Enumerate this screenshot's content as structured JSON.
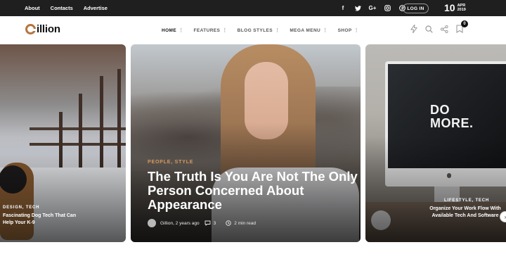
{
  "topbar": {
    "links": [
      "About",
      "Contacts",
      "Advertise"
    ],
    "socials": [
      {
        "icon": "facebook-icon",
        "glyph": "f"
      },
      {
        "icon": "twitter-icon",
        "glyph": "🐦"
      },
      {
        "icon": "google-plus-icon",
        "glyph": "G+"
      },
      {
        "icon": "instagram-icon",
        "glyph": "◎"
      },
      {
        "icon": "pinterest-icon",
        "glyph": "℗"
      }
    ],
    "login_label": "LOG IN",
    "date": {
      "day": "10",
      "month": "APR",
      "year": "2019"
    }
  },
  "header": {
    "logo_text": "illion",
    "nav": [
      {
        "label": "HOME",
        "active": true
      },
      {
        "label": "FEATURES",
        "active": false
      },
      {
        "label": "BLOG STYLES",
        "active": false
      },
      {
        "label": "MEGA MENU",
        "active": false
      },
      {
        "label": "SHOP",
        "active": false
      }
    ],
    "nav_dots": "⋮",
    "icons": [
      "flash-icon",
      "search-icon",
      "share-icon",
      "cart-icon"
    ],
    "cart_count": "0"
  },
  "cards": {
    "left": {
      "category": "DESIGN, TECH",
      "title": "Fascinating Dog Tech That Can Help Your K-9"
    },
    "center": {
      "category": "PEOPLE, STYLE",
      "title": "The Truth Is You Are Not The Only Person Concerned About Appearance",
      "author": "Gillion",
      "time_ago": "2 years ago",
      "comments": "3",
      "read_time": "2 min read"
    },
    "right": {
      "category": "LIFESTYLE, TECH",
      "title": "Organize Your Work Flow With Available Tech And Software",
      "screen_text_line1": "DO",
      "screen_text_line2": "MORE."
    }
  },
  "colors": {
    "topbar_bg": "#1f1f1f",
    "accent": "#d79a5c",
    "logo_accent": "#b5763f"
  }
}
